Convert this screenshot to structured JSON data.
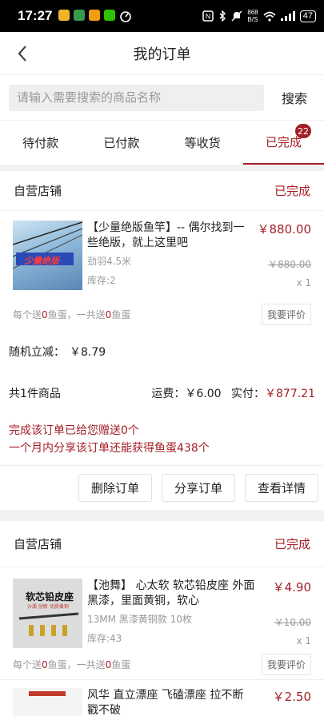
{
  "status_bar": {
    "time": "17:27",
    "speed_top": "868",
    "speed_bottom": "B/S",
    "battery": "47"
  },
  "header": {
    "title": "我的订单"
  },
  "search": {
    "placeholder": "请输入需要搜索的商品名称",
    "button": "搜索"
  },
  "tabs": [
    {
      "label": "待付款"
    },
    {
      "label": "已付款"
    },
    {
      "label": "等收货"
    },
    {
      "label": "已完成",
      "badge": "22"
    }
  ],
  "orders": [
    {
      "store": "自营店铺",
      "status": "已完成",
      "product": {
        "name": "【少量绝版鱼竿】-- 偶尔找到一些绝版，就上这里吧",
        "spec": "劲羽4.5米",
        "stock": "库存:2",
        "price": "￥880.00",
        "orig_price": "￥880.00",
        "qty": "x 1",
        "image_text": "少量绝版"
      },
      "gift": {
        "prefix": "每个送",
        "per": "0",
        "mid": "鱼蛋，一共送",
        "total": "0",
        "suffix": "鱼蛋"
      },
      "review": "我要评价",
      "discount_label": "随机立减：",
      "discount_value": "￥8.79",
      "count_label": "共1件商品",
      "shipping": "运费：￥6.00",
      "paid_label": "实付：",
      "paid_value": "￥877.21",
      "notice1": "完成该订单已给您赠送0个",
      "notice2": "一个月内分享该订单还能获得鱼蛋438个",
      "actions": [
        "删除订单",
        "分享订单",
        "查看详情"
      ]
    },
    {
      "store": "自营店铺",
      "status": "已完成",
      "product": {
        "name": "【池舞】 心太软 软芯铅皮座 外面黑漆，里面黄铜，软心",
        "spec": "13MM 黑漆黄铜款 10枚",
        "stock": "库存:43",
        "price": "￥4.90",
        "orig_price": "￥10.00",
        "qty": "x 1",
        "image_text": "软芯铅皮座",
        "image_sub": "沙漏 创新 优质黄铜"
      },
      "gift": {
        "prefix": "每个送",
        "per": "0",
        "mid": "鱼蛋，一共送",
        "total": "0",
        "suffix": "鱼蛋"
      },
      "review": "我要评价"
    },
    {
      "product": {
        "name": "风华 直立漂座 飞磕漂座 拉不断 戳不破",
        "price": "￥2.50"
      }
    }
  ]
}
